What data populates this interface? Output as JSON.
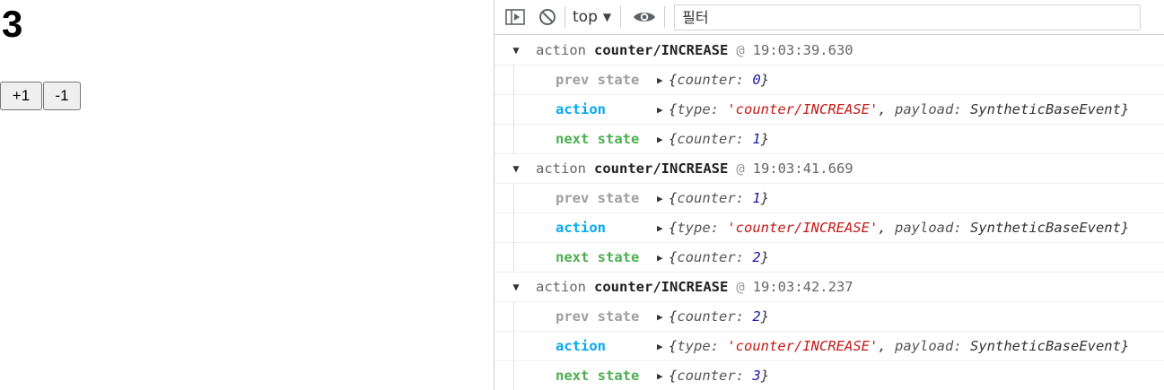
{
  "app": {
    "counter": "3",
    "plus_label": "+1",
    "minus_label": "-1"
  },
  "devtools": {
    "context": "top",
    "filter_placeholder": "필터",
    "groups": [
      {
        "prefix": "action",
        "type": "counter/INCREASE",
        "at": "@",
        "time": "19:03:39.630",
        "prev_label": "prev state",
        "prev_value": "0",
        "action_label": "action",
        "action_type": "'counter/INCREASE'",
        "action_payload": "SyntheticBaseEvent",
        "next_label": "next state",
        "next_value": "1"
      },
      {
        "prefix": "action",
        "type": "counter/INCREASE",
        "at": "@",
        "time": "19:03:41.669",
        "prev_label": "prev state",
        "prev_value": "1",
        "action_label": "action",
        "action_type": "'counter/INCREASE'",
        "action_payload": "SyntheticBaseEvent",
        "next_label": "next state",
        "next_value": "2"
      },
      {
        "prefix": "action",
        "type": "counter/INCREASE",
        "at": "@",
        "time": "19:03:42.237",
        "prev_label": "prev state",
        "prev_value": "2",
        "action_label": "action",
        "action_type": "'counter/INCREASE'",
        "action_payload": "SyntheticBaseEvent",
        "next_label": "next state",
        "next_value": "3"
      }
    ]
  }
}
